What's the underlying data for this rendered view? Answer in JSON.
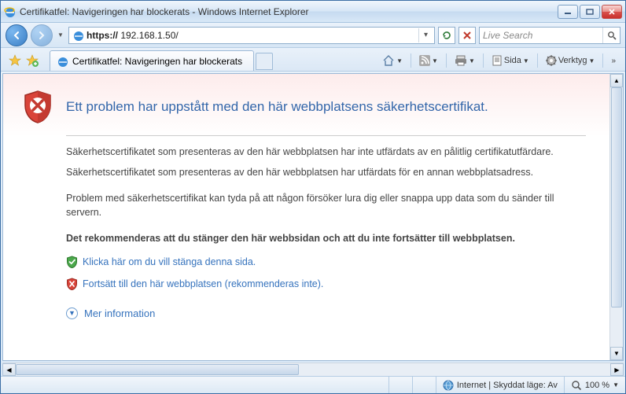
{
  "window": {
    "title": "Certifikatfel: Navigeringen har blockerats - Windows Internet Explorer"
  },
  "address": {
    "url_prefix": "https://",
    "url_rest": " 192.168.1.50/"
  },
  "search": {
    "placeholder": "Live Search"
  },
  "tab": {
    "title": "Certifikatfel: Navigeringen har blockerats"
  },
  "toolbar": {
    "page_label": "Sida",
    "tools_label": "Verktyg"
  },
  "page": {
    "heading": "Ett problem har uppstått med den här webbplatsens säkerhetscertifikat.",
    "para1": "Säkerhetscertifikatet som presenteras av den här webbplatsen har inte utfärdats av en pålitlig certifikatutfärdare.",
    "para2": "Säkerhetscertifikatet som presenteras av den här webbplatsen har utfärdats för en annan webbplatsadress.",
    "para3": "Problem med säkerhetscertifikat kan tyda på att någon försöker lura dig eller snappa upp data som du sänder till servern.",
    "recommendation": "Det rekommenderas att du stänger den här webbsidan och att du inte fortsätter till webbplatsen.",
    "close_link": "Klicka här om du vill stänga denna sida.",
    "continue_link": "Fortsätt till den här webbplatsen (rekommenderas inte).",
    "more_info": "Mer information"
  },
  "status": {
    "zone": "Internet | Skyddat läge: Av",
    "zoom": "100 %"
  }
}
